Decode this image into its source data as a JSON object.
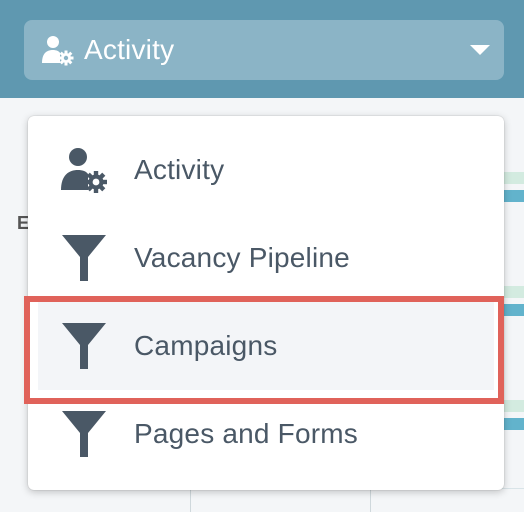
{
  "header": {
    "selected_label": "Activity",
    "selected_icon": "user-gear-icon"
  },
  "background": {
    "partial_letter": "E"
  },
  "menu": {
    "items": [
      {
        "label": "Activity",
        "icon": "user-gear-icon"
      },
      {
        "label": "Vacancy Pipeline",
        "icon": "funnel-icon"
      },
      {
        "label": "Campaigns",
        "icon": "funnel-icon",
        "highlighted": true
      },
      {
        "label": "Pages and Forms",
        "icon": "funnel-icon"
      }
    ]
  },
  "colors": {
    "header_bg": "#5f98b0",
    "select_bg": "#8bb4c6",
    "icon_color": "#4a5866",
    "highlight_border": "#e0625a"
  }
}
